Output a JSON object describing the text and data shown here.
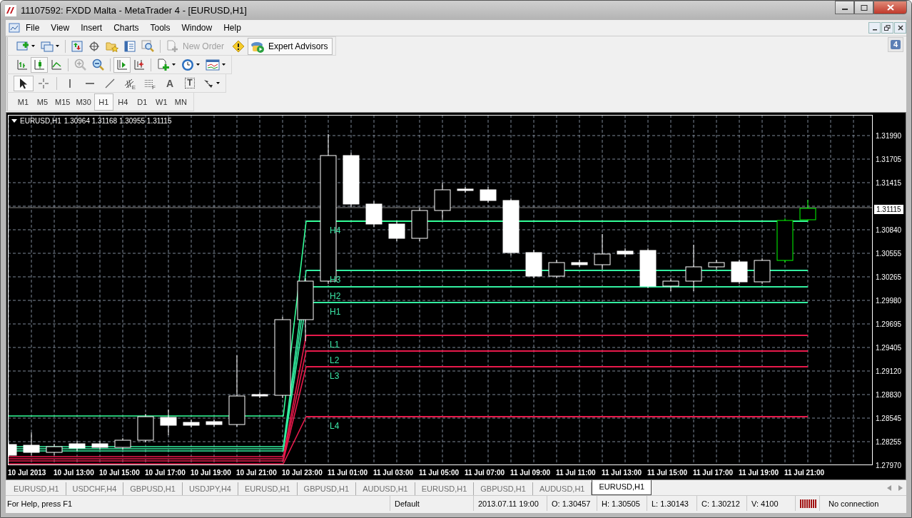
{
  "window": {
    "title": "11107592: FXDD Malta - MetaTrader 4 - [EURUSD,H1]"
  },
  "menu": [
    "File",
    "View",
    "Insert",
    "Charts",
    "Tools",
    "Window",
    "Help"
  ],
  "notifications": {
    "count": "4"
  },
  "toolbar": {
    "new_order": {
      "label": "New Order",
      "disabled": true
    },
    "expert_advisors": {
      "label": "Expert Advisors",
      "selected": true
    }
  },
  "chart_type_buttons": [
    {
      "selected": false
    },
    {
      "selected": true
    },
    {
      "selected": false
    }
  ],
  "zoom_buttons": [
    {
      "disabled": true
    },
    {
      "disabled": false
    }
  ],
  "scroll_buttons": [
    {
      "selected": true
    },
    {
      "selected": false
    }
  ],
  "draw_tools": [
    {
      "selected": true
    },
    {
      "selected": false
    },
    {
      "selected": false
    },
    {
      "selected": false
    },
    {
      "selected": false
    },
    {
      "selected": false,
      "glyph": "E"
    },
    {
      "selected": false,
      "glyph": "F"
    },
    {
      "selected": false,
      "glyph": "A"
    },
    {
      "selected": false,
      "glyph": "T"
    },
    {
      "selected": false
    }
  ],
  "timeframes": [
    {
      "label": "M1",
      "selected": false
    },
    {
      "label": "M5",
      "selected": false
    },
    {
      "label": "M15",
      "selected": false
    },
    {
      "label": "M30",
      "selected": false
    },
    {
      "label": "H1",
      "selected": true
    },
    {
      "label": "H4",
      "selected": false
    },
    {
      "label": "D1",
      "selected": false
    },
    {
      "label": "W1",
      "selected": false
    },
    {
      "label": "MN",
      "selected": false
    }
  ],
  "chart": {
    "header": {
      "symbol": "EURUSD,H1",
      "quote": "1.30964 1.31168 1.30955 1.31115"
    },
    "price_labels": [
      "1.31990",
      "1.31705",
      "1.31415",
      "1.30840",
      "1.30555",
      "1.30265",
      "1.29980",
      "1.29695",
      "1.29405",
      "1.29120",
      "1.28830",
      "1.28545",
      "1.28255",
      "1.27970"
    ],
    "current_price": "1.31115",
    "time_labels": [
      "10 Jul 2013",
      "10 Jul 13:00",
      "10 Jul 15:00",
      "10 Jul 17:00",
      "10 Jul 19:00",
      "10 Jul 21:00",
      "10 Jul 23:00",
      "11 Jul 01:00",
      "11 Jul 03:00",
      "11 Jul 05:00",
      "11 Jul 07:00",
      "11 Jul 09:00",
      "11 Jul 11:00",
      "11 Jul 13:00",
      "11 Jul 15:00",
      "11 Jul 17:00",
      "11 Jul 19:00",
      "11 Jul 21:00"
    ],
    "levels": [
      {
        "label": "H4",
        "color": "#33ff99"
      },
      {
        "label": "H3",
        "color": "#33eea0"
      },
      {
        "label": "H2",
        "color": "#33eea0"
      },
      {
        "label": "H1",
        "color": "#33eea0"
      },
      {
        "label": "L1",
        "color": "#e8194b"
      },
      {
        "label": "L2",
        "color": "#e8194b"
      },
      {
        "label": "L3",
        "color": "#e8194b"
      },
      {
        "label": "L4",
        "color": "#e8194b"
      }
    ]
  },
  "chart_tabs": [
    {
      "label": "EURUSD,H1",
      "selected": false
    },
    {
      "label": "USDCHF,H4",
      "selected": false
    },
    {
      "label": "GBPUSD,H1",
      "selected": false
    },
    {
      "label": "USDJPY,H4",
      "selected": false
    },
    {
      "label": "EURUSD,H1",
      "selected": false
    },
    {
      "label": "GBPUSD,H1",
      "selected": false
    },
    {
      "label": "AUDUSD,H1",
      "selected": false
    },
    {
      "label": "EURUSD,H1",
      "selected": false
    },
    {
      "label": "GBPUSD,H1",
      "selected": false
    },
    {
      "label": "AUDUSD,H1",
      "selected": false
    },
    {
      "label": "EURUSD,H1",
      "selected": true
    }
  ],
  "status_bar": {
    "help": "For Help, press F1",
    "profile": "Default",
    "time": "2013.07.11 19:00",
    "open": "O: 1.30457",
    "high": "H: 1.30505",
    "low": "L: 1.30143",
    "close": "C: 1.30212",
    "volume": "V: 4100",
    "connection": "No connection"
  }
}
